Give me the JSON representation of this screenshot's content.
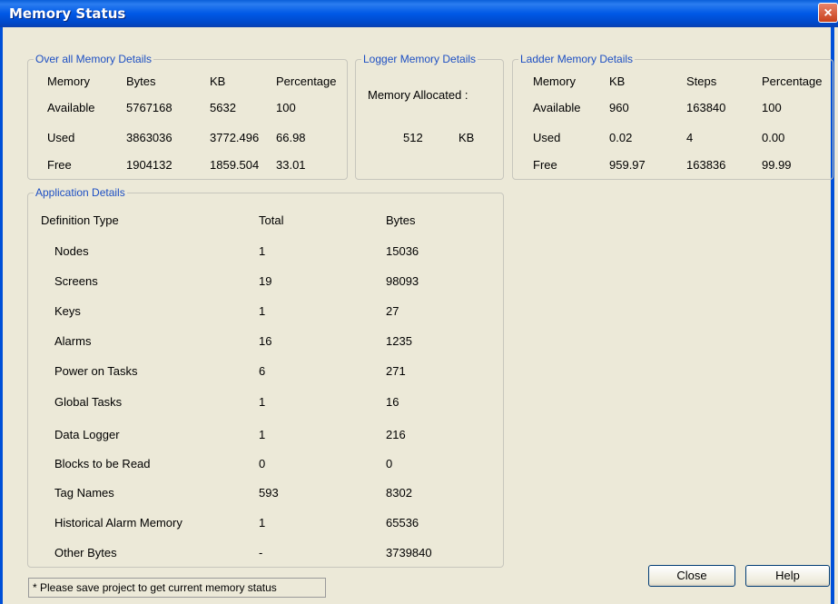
{
  "window": {
    "title": "Memory Status",
    "close_glyph": "×"
  },
  "overall": {
    "legend": "Over all Memory Details",
    "headers": [
      "Memory",
      "Bytes",
      "KB",
      "Percentage"
    ],
    "rows": [
      [
        "Available",
        "5767168",
        "5632",
        "100"
      ],
      [
        "Used",
        "3863036",
        "3772.496",
        "66.98"
      ],
      [
        "Free",
        "1904132",
        "1859.504",
        "33.01"
      ]
    ]
  },
  "logger": {
    "legend": "Logger Memory Details",
    "allocated_label": "Memory  Allocated :",
    "value": "512",
    "unit": "KB"
  },
  "ladder": {
    "legend": "Ladder Memory Details",
    "headers": [
      "Memory",
      "KB",
      "Steps",
      "Percentage"
    ],
    "rows": [
      [
        "Available",
        "960",
        "163840",
        "100"
      ],
      [
        "Used",
        "0.02",
        "4",
        "0.00"
      ],
      [
        "Free",
        "959.97",
        "163836",
        "99.99"
      ]
    ]
  },
  "application": {
    "legend": "Application Details",
    "headers": [
      "Definition Type",
      "Total",
      "Bytes"
    ],
    "rows": [
      [
        "Nodes",
        "1",
        "15036"
      ],
      [
        "Screens",
        "19",
        "98093"
      ],
      [
        "Keys",
        "1",
        "27"
      ],
      [
        "Alarms",
        "16",
        "1235"
      ],
      [
        "Power on Tasks",
        "6",
        "271"
      ],
      [
        "Global Tasks",
        "1",
        "16"
      ],
      [
        "Data Logger",
        "1",
        "216"
      ],
      [
        "Blocks to be Read",
        "0",
        "0"
      ],
      [
        "Tag Names",
        "593",
        "8302"
      ],
      [
        "Historical Alarm Memory",
        "1",
        "65536"
      ],
      [
        "Other Bytes",
        "-",
        "3739840"
      ]
    ]
  },
  "status_text": "* Please save project to get current memory status",
  "buttons": {
    "close": "Close",
    "help": "Help"
  }
}
